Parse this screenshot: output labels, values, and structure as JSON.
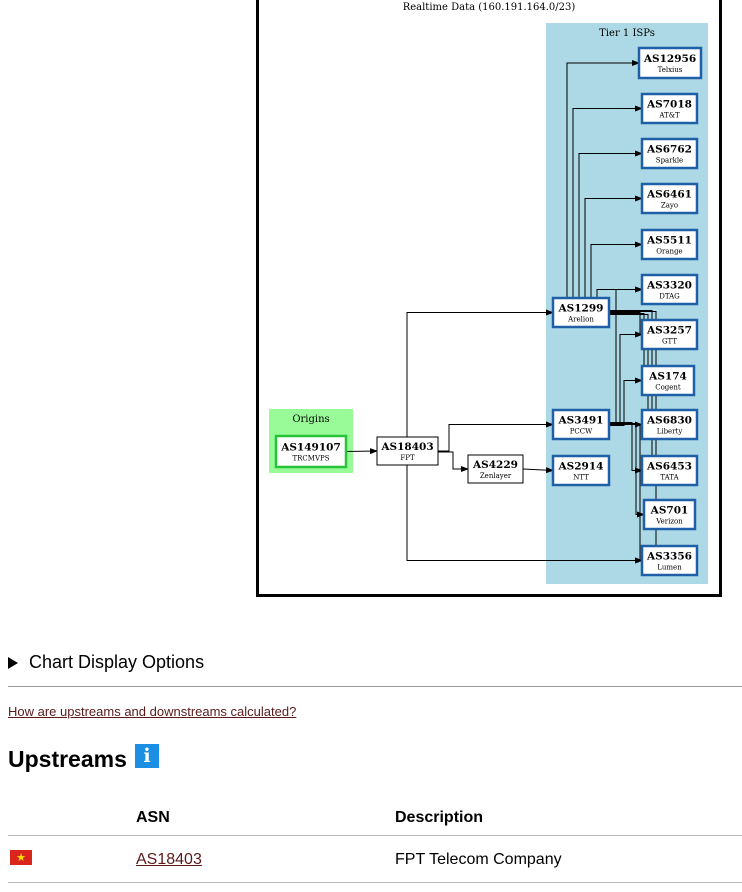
{
  "graph": {
    "title": "Realtime Data (160.191.164.0/23)",
    "tier1_label": "Tier 1 ISPs",
    "origins_label": "Origins",
    "colors": {
      "tier1_bg": "#add8e6",
      "origins_bg": "#98fb98",
      "node_border_blue": "#1f5fa8",
      "node_border_green": "#27c43a",
      "frame": "#000000"
    },
    "nodes": [
      {
        "id": "AS149107",
        "asn": "AS149107",
        "name": "TRCMVPS"
      },
      {
        "id": "AS18403",
        "asn": "AS18403",
        "name": "FPT"
      },
      {
        "id": "AS4229",
        "asn": "AS4229",
        "name": "Zenlayer"
      },
      {
        "id": "AS1299",
        "asn": "AS1299",
        "name": "Arelion"
      },
      {
        "id": "AS3491",
        "asn": "AS3491",
        "name": "PCCW"
      },
      {
        "id": "AS2914",
        "asn": "AS2914",
        "name": "NTT"
      },
      {
        "id": "AS12956",
        "asn": "AS12956",
        "name": "Telxius"
      },
      {
        "id": "AS7018",
        "asn": "AS7018",
        "name": "AT&T"
      },
      {
        "id": "AS6762",
        "asn": "AS6762",
        "name": "Sparkle"
      },
      {
        "id": "AS6461",
        "asn": "AS6461",
        "name": "Zayo"
      },
      {
        "id": "AS5511",
        "asn": "AS5511",
        "name": "Orange"
      },
      {
        "id": "AS3320",
        "asn": "AS3320",
        "name": "DTAG"
      },
      {
        "id": "AS3257",
        "asn": "AS3257",
        "name": "GTT"
      },
      {
        "id": "AS174",
        "asn": "AS174",
        "name": "Cogent"
      },
      {
        "id": "AS6830",
        "asn": "AS6830",
        "name": "Liberty"
      },
      {
        "id": "AS6453",
        "asn": "AS6453",
        "name": "TATA"
      },
      {
        "id": "AS701",
        "asn": "AS701",
        "name": "Verizon"
      },
      {
        "id": "AS3356",
        "asn": "AS3356",
        "name": "Lumen"
      }
    ],
    "edges": [
      [
        "AS149107",
        "AS18403"
      ],
      [
        "AS18403",
        "AS1299"
      ],
      [
        "AS18403",
        "AS3491"
      ],
      [
        "AS18403",
        "AS4229"
      ],
      [
        "AS18403",
        "AS3356"
      ],
      [
        "AS4229",
        "AS2914"
      ],
      [
        "AS1299",
        "AS12956"
      ],
      [
        "AS1299",
        "AS7018"
      ],
      [
        "AS1299",
        "AS6762"
      ],
      [
        "AS1299",
        "AS6461"
      ],
      [
        "AS1299",
        "AS5511"
      ],
      [
        "AS1299",
        "AS3320"
      ],
      [
        "AS1299",
        "AS3257"
      ],
      [
        "AS1299",
        "AS174"
      ],
      [
        "AS1299",
        "AS6830"
      ],
      [
        "AS1299",
        "AS6453"
      ],
      [
        "AS1299",
        "AS3356"
      ],
      [
        "AS3491",
        "AS3320"
      ],
      [
        "AS3491",
        "AS3257"
      ],
      [
        "AS3491",
        "AS174"
      ],
      [
        "AS3491",
        "AS6830"
      ],
      [
        "AS3491",
        "AS6453"
      ],
      [
        "AS3491",
        "AS701"
      ],
      [
        "AS3491",
        "AS3356"
      ]
    ]
  },
  "details": {
    "summary": "Chart Display Options"
  },
  "help_link": "How are upstreams and downstreams calculated?",
  "upstreams": {
    "title": "Upstreams",
    "info_icon": "info-icon",
    "columns": {
      "asn": "ASN",
      "description": "Description"
    },
    "rows": [
      {
        "flag": "vn-flag",
        "flag_glyph": "★",
        "asn": "AS18403",
        "description": "FPT Telecom Company"
      }
    ]
  }
}
